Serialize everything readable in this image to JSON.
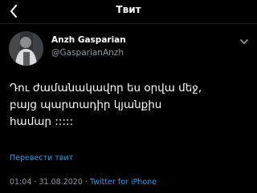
{
  "header": {
    "title": "Твит"
  },
  "tweet": {
    "author_name": "Anzh Gasparian",
    "author_handle": "@GasparianAnzh",
    "text_lines": [
      "Դու ժամանակավոր ես օրվա մեջ,",
      "բայց պարտադիր կյանքիս",
      "համար :::::"
    ],
    "translate_label": "Перевести твит",
    "time": "01:04",
    "separator": "·",
    "date": "31.08.2020",
    "source": "Twitter for iPhone"
  },
  "colors": {
    "background": "#000000",
    "text": "#ffffff",
    "secondary": "#8b98a5",
    "accent": "#1d9bf0"
  },
  "icons": {
    "back": "chevron-left-icon",
    "more": "chevron-down-icon"
  }
}
